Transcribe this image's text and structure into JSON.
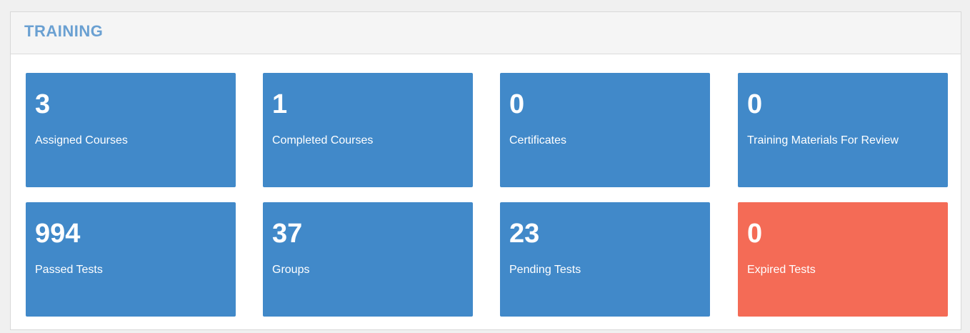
{
  "panel": {
    "title": "TRAINING",
    "title_color": "#6aa0d2"
  },
  "colors": {
    "tile_blue": "#4189c9",
    "tile_red": "#f46b56"
  },
  "tiles": [
    {
      "value": "3",
      "label": "Assigned Courses",
      "color": "#4189c9"
    },
    {
      "value": "1",
      "label": "Completed Courses",
      "color": "#4189c9"
    },
    {
      "value": "0",
      "label": "Certificates",
      "color": "#4189c9"
    },
    {
      "value": "0",
      "label": "Training Materials For Review",
      "color": "#4189c9"
    },
    {
      "value": "994",
      "label": "Passed Tests",
      "color": "#4189c9"
    },
    {
      "value": "37",
      "label": "Groups",
      "color": "#4189c9"
    },
    {
      "value": "23",
      "label": "Pending Tests",
      "color": "#4189c9"
    },
    {
      "value": "0",
      "label": "Expired Tests",
      "color": "#f46b56"
    }
  ]
}
